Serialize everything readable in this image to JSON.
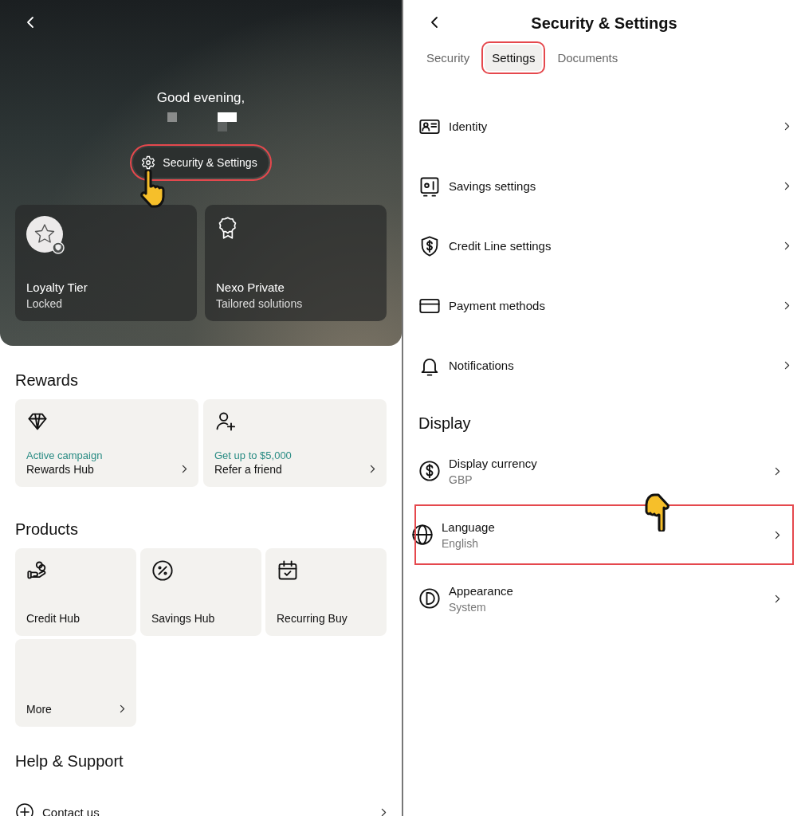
{
  "home": {
    "greeting": "Good evening,",
    "settings_button": {
      "label": "Security & Settings",
      "highlighted": true,
      "pointer": true
    },
    "cards": [
      {
        "kind": "loyalty",
        "title": "Loyalty Tier",
        "subtitle": "Locked"
      },
      {
        "kind": "private",
        "title": "Nexo Private",
        "subtitle": "Tailored solutions"
      }
    ],
    "rewards": {
      "heading": "Rewards",
      "cards": [
        {
          "kind": "rewards",
          "tag": "Active campaign",
          "title": "Rewards Hub"
        },
        {
          "kind": "referral",
          "tag": "Get up to $5,000",
          "title": "Refer a friend"
        }
      ]
    },
    "products": {
      "heading": "Products",
      "cards": [
        {
          "kind": "credit",
          "title": "Credit Hub"
        },
        {
          "kind": "savings",
          "title": "Savings Hub"
        },
        {
          "kind": "recurring",
          "title": "Recurring Buy"
        },
        {
          "kind": "more",
          "title": "More"
        }
      ]
    },
    "support": {
      "heading": "Help & Support",
      "items": [
        {
          "kind": "contact",
          "label": "Contact us"
        }
      ]
    }
  },
  "settings": {
    "title": "Security & Settings",
    "tabs": [
      {
        "label": "Security",
        "selected": false,
        "highlighted": false
      },
      {
        "label": "Settings",
        "selected": true,
        "highlighted": true
      },
      {
        "label": "Documents",
        "selected": false,
        "highlighted": false
      }
    ],
    "items": [
      {
        "kind": "identity",
        "label": "Identity",
        "highlighted": false,
        "pointer": false
      },
      {
        "kind": "savings",
        "label": "Savings settings",
        "highlighted": false,
        "pointer": false
      },
      {
        "kind": "credit",
        "label": "Credit Line settings",
        "highlighted": false,
        "pointer": false
      },
      {
        "kind": "payment",
        "label": "Payment methods",
        "highlighted": false,
        "pointer": false
      },
      {
        "kind": "notifications",
        "label": "Notifications",
        "highlighted": false,
        "pointer": false
      }
    ],
    "display": {
      "heading": "Display",
      "items": [
        {
          "kind": "currency",
          "label": "Display currency",
          "value": "GBP",
          "highlighted": false,
          "pointer": false
        },
        {
          "kind": "language",
          "label": "Language",
          "value": "English",
          "highlighted": true,
          "pointer": true
        },
        {
          "kind": "appearance",
          "label": "Appearance",
          "value": "System",
          "highlighted": false,
          "pointer": false
        }
      ]
    }
  }
}
